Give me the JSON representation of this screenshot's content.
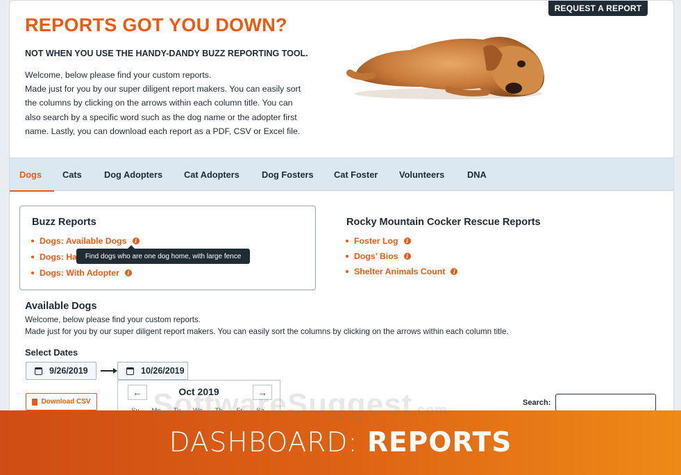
{
  "header": {
    "request_button": "REQUEST A REPORT",
    "title": "REPORTS GOT YOU DOWN?",
    "subtitle": "NOT WHEN YOU USE THE HANDY-DANDY BUZZ REPORTING TOOL.",
    "intro_lines": [
      "Welcome, below please find your custom reports.",
      "Made just for you by our super diligent report makers. You can easily sort",
      "the columns by clicking on the arrows within each column title. You can",
      "also search by a specific word such as the dog name or the adopter first",
      "name. Lastly, you can download each report as a PDF, CSV or Excel file."
    ]
  },
  "tabs": [
    {
      "label": "Dogs",
      "active": true
    },
    {
      "label": "Cats"
    },
    {
      "label": "Dog Adopters"
    },
    {
      "label": "Cat Adopters"
    },
    {
      "label": "Dog Fosters"
    },
    {
      "label": "Cat Foster"
    },
    {
      "label": "Volunteers"
    },
    {
      "label": "DNA"
    }
  ],
  "buzz_reports": {
    "title": "Buzz Reports",
    "items": [
      "Dogs: Available Dogs",
      "Dogs: Ha",
      "Dogs: With Adopter"
    ],
    "tooltip": "Find dogs who are one dog home, with large fence"
  },
  "rocky_reports": {
    "title": "Rocky Mountain Cocker Rescue Reports",
    "items": [
      "Foster Log",
      "Dogs’ Bios",
      "Shelter Animals Count"
    ]
  },
  "available": {
    "title": "Available Dogs",
    "line1": "Welcome, below please find your custom reports.",
    "line2": "Made just for you by our super diligent report makers. You can easily sort the columns by clicking on the arrows within each column title.",
    "select_dates": "Select Dates",
    "start_date": "9/26/2019",
    "end_date": "10/26/2019",
    "calendar_month": "Oct 2019",
    "weekdays": [
      "Su",
      "Mo",
      "Tu",
      "We",
      "Th",
      "Fr",
      "Sa"
    ],
    "download_csv": "Download CSV",
    "search_label": "Search:"
  },
  "banner": {
    "light": "DASHBOARD: ",
    "bold": "REPORTS"
  },
  "watermark": {
    "main": "SoftwareSuggest",
    "suffix": ".com"
  },
  "colors": {
    "accent": "#ea5a12",
    "dark": "#1f2b35",
    "tabbar": "#dbe8f1"
  }
}
